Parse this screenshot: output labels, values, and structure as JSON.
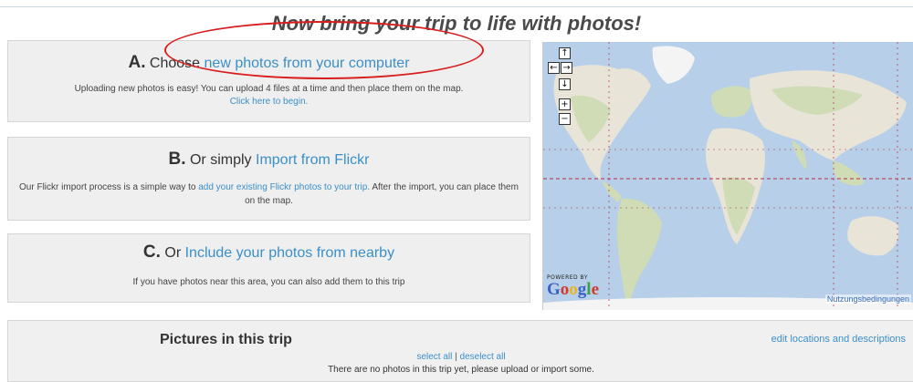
{
  "page": {
    "title": "Now bring your trip to life with photos!"
  },
  "option_a": {
    "letter": "A.",
    "prefix": "Choose",
    "link": "new photos from your computer",
    "description": "Uploading new photos is easy! You can upload 4 files at a time and then place them on the map.",
    "cta": "Click here to begin."
  },
  "option_b": {
    "letter": "B.",
    "prefix": "Or simply",
    "link": "Import from Flickr",
    "description_before": "Our Flickr import process is a simple way to",
    "description_link": "add your existing Flickr photos to your trip.",
    "description_after": "After the import, you can place them on the map."
  },
  "option_c": {
    "letter": "C.",
    "prefix": "Or",
    "link": "Include your photos from nearby",
    "description": "If you have photos near this area, you can also add them to this trip"
  },
  "map": {
    "controls": {
      "pan_up": "↑",
      "pan_left": "←",
      "pan_right": "→",
      "pan_down": "↓",
      "zoom_in": "+",
      "zoom_out": "−"
    },
    "powered_by": "POWERED BY",
    "logo": {
      "g1": "G",
      "g2": "o",
      "g3": "o",
      "g4": "g",
      "g5": "l",
      "g6": "e"
    },
    "terms": "Nutzungsbedingungen",
    "colors": {
      "water": "#b7cfe8",
      "land": "#e8e4d8",
      "vegetation": "#cfdcb6",
      "ice": "#f4f4f4",
      "grid": "#b2304a"
    }
  },
  "pictures": {
    "title": "Pictures in this trip",
    "edit_link": "edit locations and descriptions",
    "select_all": "select all",
    "separator": "|",
    "deselect_all": "deselect all",
    "empty_message": "There are no photos in this trip yet, please upload or import some."
  },
  "colors": {
    "link": "#3b8fc7",
    "panel_bg": "#efefef",
    "annotation": "#d81e1e"
  }
}
